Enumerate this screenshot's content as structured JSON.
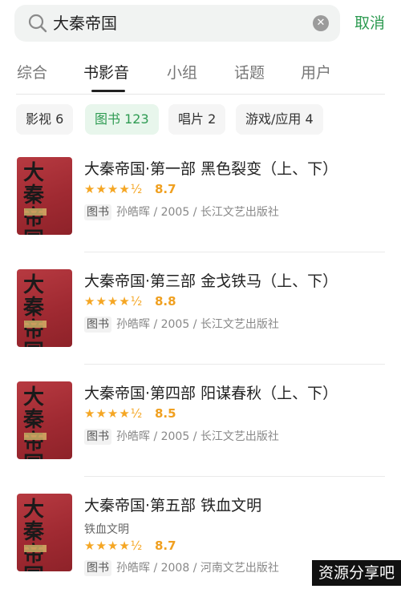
{
  "search": {
    "query": "大秦帝国",
    "cancel_label": "取消"
  },
  "tabs": [
    {
      "label": "综合"
    },
    {
      "label": "书影音"
    },
    {
      "label": "小组"
    },
    {
      "label": "话题"
    },
    {
      "label": "用户"
    }
  ],
  "filters": [
    {
      "label": "影视 6"
    },
    {
      "label": "图书 123"
    },
    {
      "label": "唱片 2"
    },
    {
      "label": "游戏/应用 4"
    }
  ],
  "results": [
    {
      "title": "大秦帝国·第一部 黑色裂变（上、下）",
      "cover_text": "大秦帝国",
      "stars": "★★★★½",
      "score": "8.7",
      "type_tag": "图书",
      "meta": "孙皓晖 / 2005 / 长江文艺出版社"
    },
    {
      "title": "大秦帝国·第三部 金戈铁马（上、下）",
      "cover_text": "大秦帝国",
      "stars": "★★★★½",
      "score": "8.8",
      "type_tag": "图书",
      "meta": "孙皓晖 / 2005 / 长江文艺出版社"
    },
    {
      "title": "大秦帝国·第四部 阳谋春秋（上、下）",
      "cover_text": "大秦帝国",
      "stars": "★★★★½",
      "score": "8.5",
      "type_tag": "图书",
      "meta": "孙皓晖 / 2005 / 长江文艺出版社"
    },
    {
      "title": "大秦帝国·第五部 铁血文明",
      "subtitle": "铁血文明",
      "cover_text": "大秦帝国",
      "stars": "★★★★½",
      "score": "8.7",
      "type_tag": "图书",
      "meta": "孙皓晖 / 2008 / 河南文艺出版社"
    }
  ],
  "watermark": "资源分享吧",
  "colors": {
    "accent": "#2e9b52",
    "star": "#f5a623",
    "cover": "#a02a32"
  }
}
